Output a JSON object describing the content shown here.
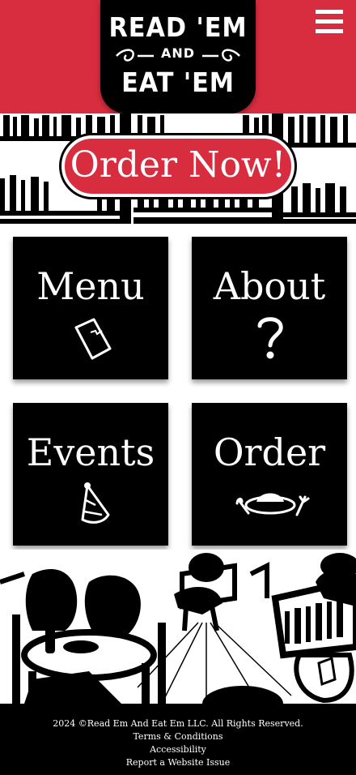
{
  "header": {
    "logo": {
      "line1": "READ 'EM",
      "line2": "AND",
      "line3": "EAT 'EM"
    },
    "menu_icon": "hamburger-menu-icon"
  },
  "hero": {
    "cta_label": "Order Now!"
  },
  "tiles": [
    {
      "label": "Menu",
      "icon": "menu-booklet-icon"
    },
    {
      "label": "About",
      "icon": "question-mark-icon"
    },
    {
      "label": "Events",
      "icon": "party-hat-icon"
    },
    {
      "label": "Order",
      "icon": "plate-cutlery-icon"
    }
  ],
  "footer": {
    "copyright": "2024 ©Read Em And Eat Em LLC. All Rights Reserved.",
    "terms": "Terms & Conditions",
    "accessibility": "Accessibility",
    "report": "Report a Website Issue"
  },
  "colors": {
    "brand_red": "#d82c3f",
    "black": "#000000",
    "white": "#ffffff"
  }
}
